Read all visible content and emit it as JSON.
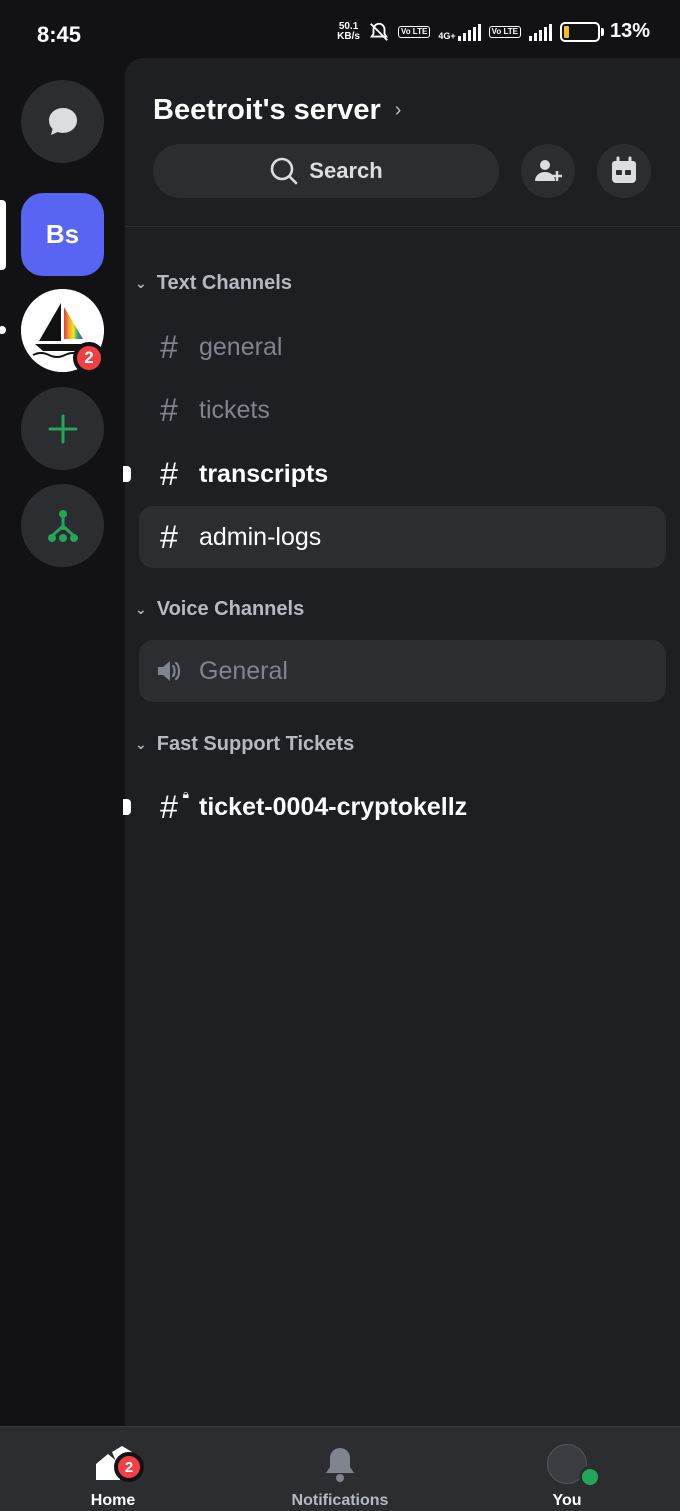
{
  "status_bar": {
    "time": "8:45",
    "net_speed_value": "50.1",
    "net_speed_unit": "KB/s",
    "volte": "Vo LTE",
    "network_type": "4G+",
    "battery_percent": "13%"
  },
  "rail": {
    "active_server_initials": "Bs",
    "server_badge_count": "2"
  },
  "server": {
    "name": "Beetroit's server",
    "search_label": "Search"
  },
  "categories": {
    "text": "Text Channels",
    "voice": "Voice Channels",
    "support": "Fast Support Tickets"
  },
  "channels": {
    "general": "general",
    "tickets": "tickets",
    "transcripts": "transcripts",
    "admin_logs": "admin-logs",
    "voice_general": "General",
    "ticket": "ticket-0004-cryptokellz"
  },
  "bottom_nav": {
    "home": "Home",
    "home_badge": "2",
    "notifications": "Notifications",
    "you": "You"
  },
  "colors": {
    "accent": "#5865f2",
    "badge": "#f23f43",
    "online": "#23a55a",
    "add_server": "#23a55a"
  }
}
